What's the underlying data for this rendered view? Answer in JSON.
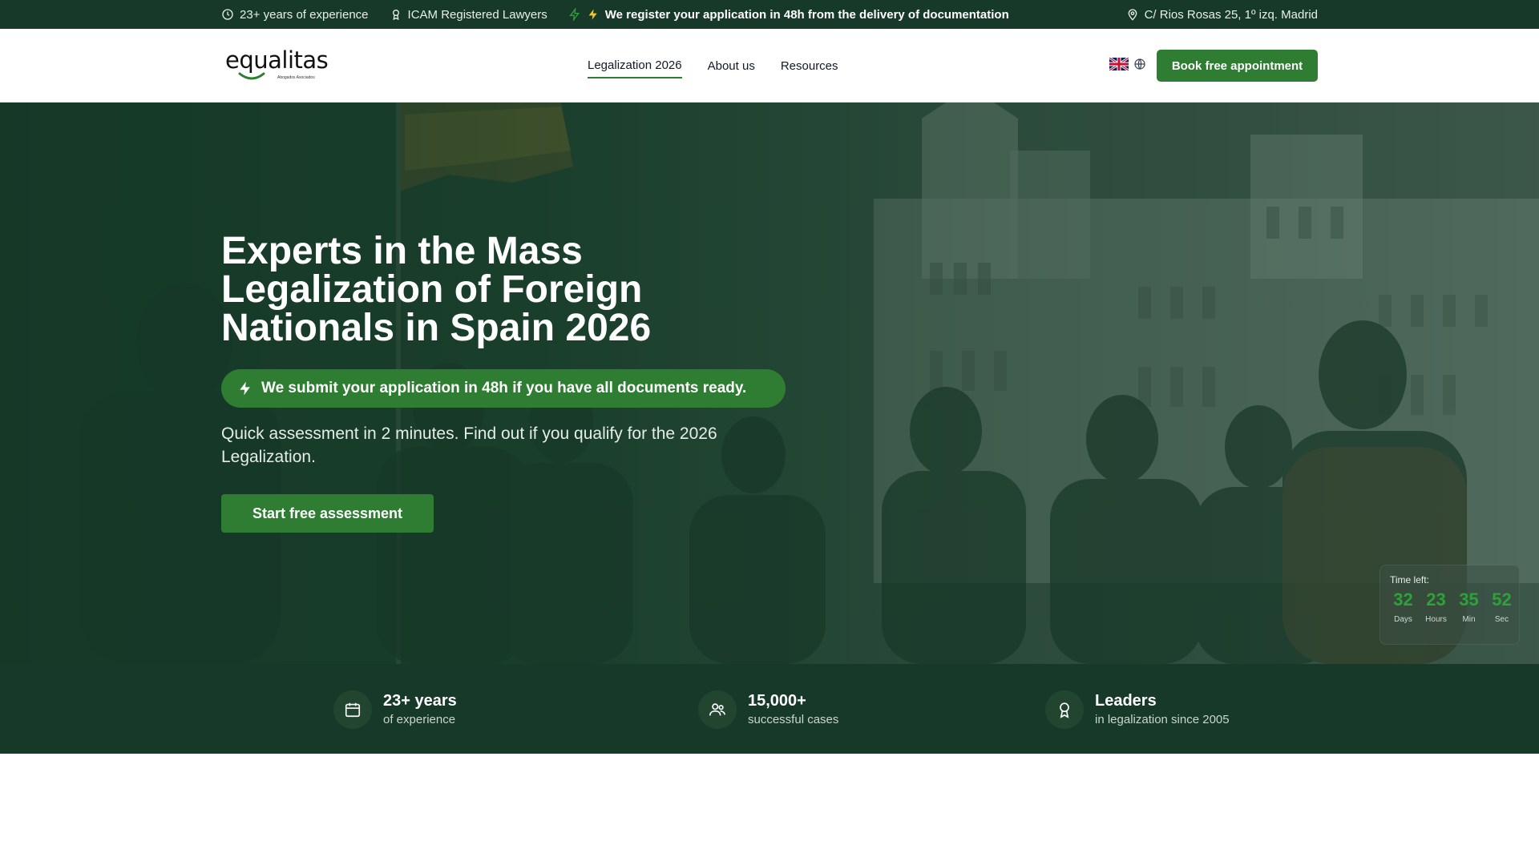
{
  "topbar": {
    "experience": "23+ years of experience",
    "registered": "ICAM Registered Lawyers",
    "promise": "We register your application in 48h from the delivery of documentation",
    "address": "C/ Rios Rosas 25, 1º izq. Madrid"
  },
  "nav": {
    "logo": "equalitas",
    "logo_sub": "Abogados Asociados",
    "links": [
      "Legalization 2026",
      "About us",
      "Resources"
    ],
    "book_label": "Book free appointment"
  },
  "hero": {
    "title": "Experts in the Mass Legalization of Foreign Nationals in Spain 2026",
    "pill": "We submit your application in 48h if you have all documents ready.",
    "subtitle": "Quick assessment in 2 minutes. Find out if you qualify for the 2026 Legalization.",
    "cta": "Start free assessment"
  },
  "countdown": {
    "label": "Time left:",
    "units": [
      {
        "value": "32",
        "caption": "Days"
      },
      {
        "value": "23",
        "caption": "Hours"
      },
      {
        "value": "35",
        "caption": "Min"
      },
      {
        "value": "52",
        "caption": "Sec"
      }
    ]
  },
  "stats": [
    {
      "title": "23+ years",
      "sub": "of experience",
      "icon": "calendar-icon"
    },
    {
      "title": "15,000+",
      "sub": "successful cases",
      "icon": "users-icon"
    },
    {
      "title": "Leaders",
      "sub": "in legalization since 2005",
      "icon": "award-icon"
    }
  ],
  "colors": {
    "brand_green": "#2e7d32",
    "dark_green": "#17392a",
    "countdown_green": "#2fa13a"
  }
}
